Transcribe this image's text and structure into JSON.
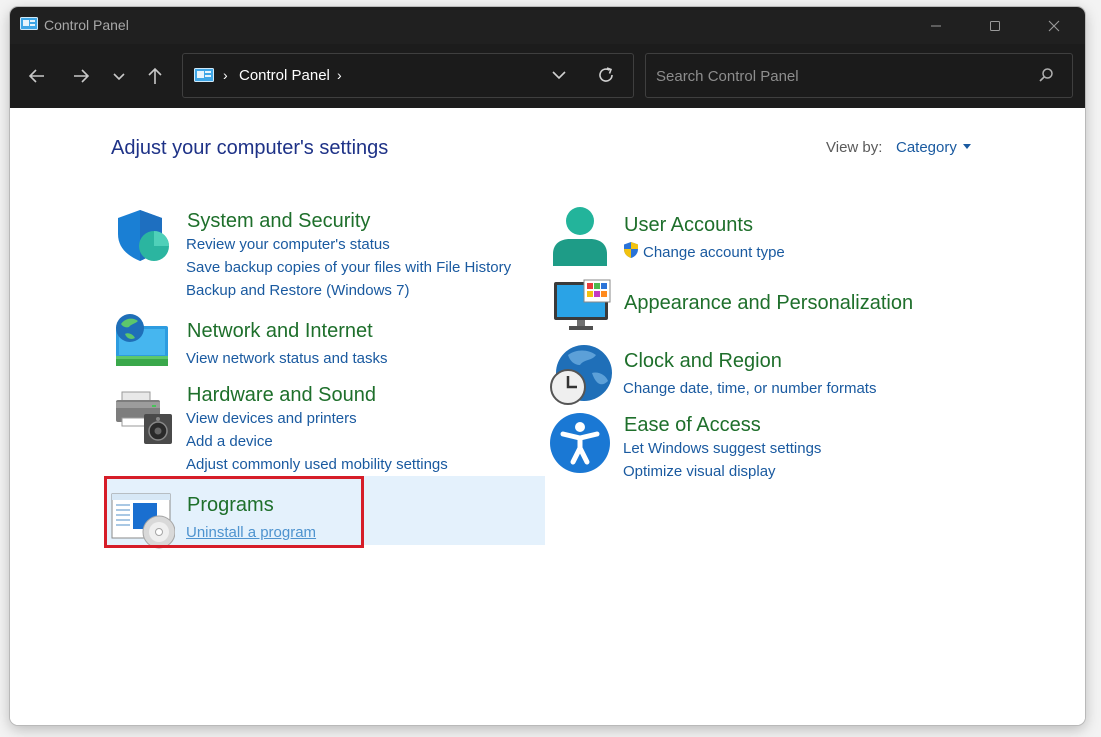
{
  "window": {
    "title": "Control Panel"
  },
  "address": {
    "crumb": "Control Panel"
  },
  "search": {
    "placeholder": "Search Control Panel"
  },
  "main": {
    "heading": "Adjust your computer's settings",
    "view_by_label": "View by:",
    "view_by_value": "Category"
  },
  "categories": [
    {
      "title": "System and Security",
      "icon": "shield-icon",
      "links": [
        "Review your computer's status",
        "Save backup copies of your files with File History",
        "Backup and Restore (Windows 7)"
      ]
    },
    {
      "title": "Network and Internet",
      "icon": "network-globe-icon",
      "links": [
        "View network status and tasks"
      ]
    },
    {
      "title": "Hardware and Sound",
      "icon": "printer-speaker-icon",
      "links": [
        "View devices and printers",
        "Add a device",
        "Adjust commonly used mobility settings"
      ]
    },
    {
      "title": "Programs",
      "icon": "programs-disc-icon",
      "links": [
        "Uninstall a program"
      ]
    },
    {
      "title": "User Accounts",
      "icon": "user-icon",
      "links": [
        "Change account type"
      ]
    },
    {
      "title": "Appearance and Personalization",
      "icon": "monitor-icon",
      "links": []
    },
    {
      "title": "Clock and Region",
      "icon": "clock-globe-icon",
      "links": [
        "Change date, time, or number formats"
      ]
    },
    {
      "title": "Ease of Access",
      "icon": "accessibility-icon",
      "links": [
        "Let Windows suggest settings",
        "Optimize visual display"
      ]
    }
  ],
  "colors": {
    "category_title": "#1e6f2b",
    "link": "#1a5aa0",
    "heading": "#1e3287",
    "highlight_border": "#d61d28",
    "hover_background": "#e4f1fc"
  }
}
